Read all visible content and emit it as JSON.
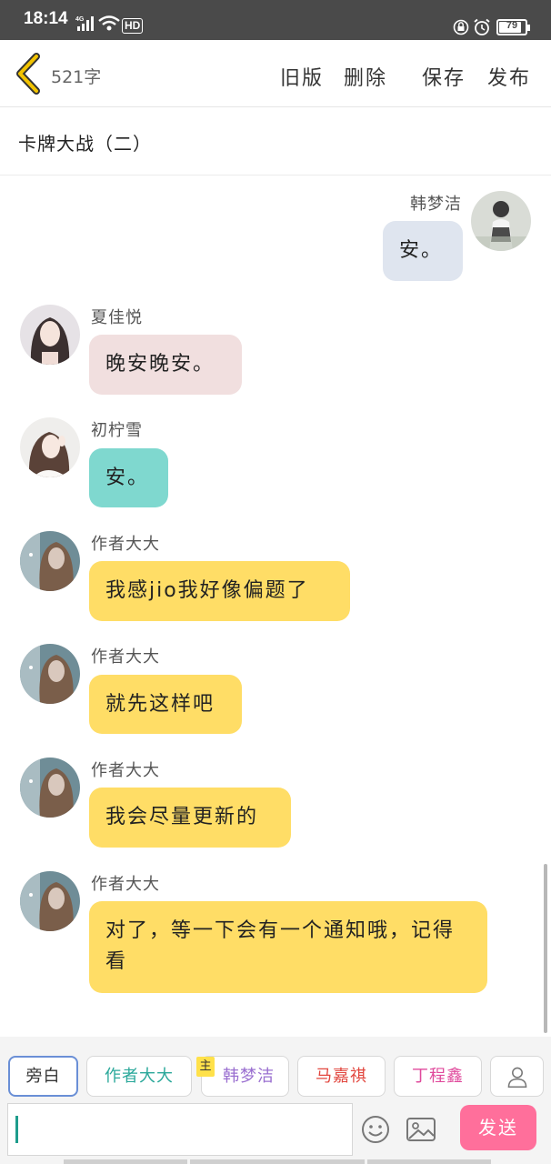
{
  "status_bar": {
    "time": "18:14",
    "network": "4G",
    "hd": "HD",
    "battery": "79"
  },
  "top_bar": {
    "word_count": "521字",
    "old_version": "旧版",
    "delete": "删除",
    "save": "保存",
    "publish": "发布"
  },
  "chapter_title": "卡牌大战（二）",
  "messages": [
    {
      "speaker": "韩梦洁",
      "text": "安。",
      "side": "right",
      "bubble_color": "#dfe5ef"
    },
    {
      "speaker": "夏佳悦",
      "text": "晚安晚安。",
      "side": "left",
      "bubble_color": "#f1dfdf"
    },
    {
      "speaker": "初柠雪",
      "text": "安。",
      "side": "left",
      "bubble_color": "#7fd8cf"
    },
    {
      "speaker": "作者大大",
      "text": "我感jio我好像偏题了",
      "side": "left",
      "bubble_color": "#ffdd66"
    },
    {
      "speaker": "作者大大",
      "text": "就先这样吧",
      "side": "left",
      "bubble_color": "#ffdd66"
    },
    {
      "speaker": "作者大大",
      "text": "我会尽量更新的",
      "side": "left",
      "bubble_color": "#ffdd66"
    },
    {
      "speaker": "作者大大",
      "text": "对了，等一下会有一个通知哦，记得看",
      "side": "left",
      "bubble_color": "#ffdd66"
    }
  ],
  "role_bar": {
    "roles": [
      {
        "label": "旁白",
        "color": "#333333",
        "active": true
      },
      {
        "label": "作者大大",
        "color": "#2aa89a",
        "active": false
      },
      {
        "label": "韩梦洁",
        "color": "#9a6fd0",
        "active": false,
        "tag": "主"
      },
      {
        "label": "马嘉祺",
        "color": "#e2473f",
        "active": false
      },
      {
        "label": "丁程鑫",
        "color": "#e04a9c",
        "active": false
      }
    ],
    "add_role_icon": "person-icon"
  },
  "input": {
    "value": "",
    "placeholder": ""
  },
  "send_label": "发送",
  "icons": {
    "back": "chevron-left-icon",
    "emoji": "emoji-icon",
    "image": "image-icon"
  },
  "colors": {
    "accent_yellow": "#f2c300",
    "send_pink": "#ff6f9b"
  }
}
